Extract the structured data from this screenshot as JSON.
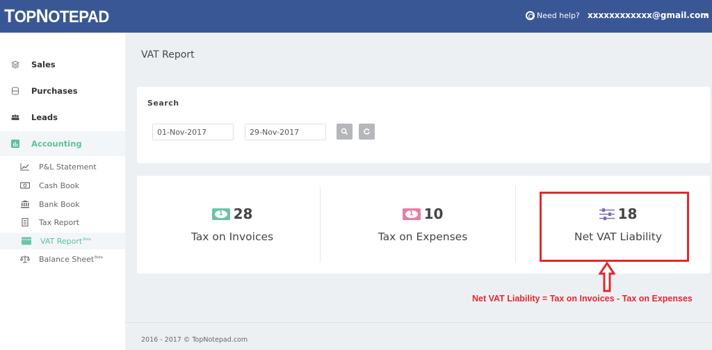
{
  "header": {
    "logo_first": "T",
    "logo_mid": "OP",
    "logo_n": "N",
    "logo_rest": "OTEPAD",
    "help_label": "Need help?",
    "user_email": "xxxxxxxxxxxx@gmail.com",
    "caret": "▾"
  },
  "sidebar": {
    "items": [
      {
        "label": "Sales",
        "icon": "layers-icon"
      },
      {
        "label": "Purchases",
        "icon": "receipt-icon"
      },
      {
        "label": "Leads",
        "icon": "users-icon"
      },
      {
        "label": "Accounting",
        "icon": "bar-chart-icon",
        "active": true
      }
    ],
    "sub_items": [
      {
        "label": "P&L Statement",
        "icon": "line-chart-icon"
      },
      {
        "label": "Cash Book",
        "icon": "money-icon"
      },
      {
        "label": "Bank Book",
        "icon": "bank-icon"
      },
      {
        "label": "Tax Report",
        "icon": "document-icon"
      },
      {
        "label": "VAT Report",
        "badge": "Beta",
        "icon": "table-icon",
        "active": true
      },
      {
        "label": "Balance Sheet",
        "badge": "Beta",
        "icon": "scale-icon"
      }
    ]
  },
  "page": {
    "title": "VAT Report",
    "search": {
      "label": "Search",
      "from_date": "01-Nov-2017",
      "to_date": "29-Nov-2017"
    },
    "stats": [
      {
        "value": "28",
        "label": "Tax on Invoices",
        "icon": "money-icon",
        "color": "#6cc3a6"
      },
      {
        "value": "10",
        "label": "Tax on Expenses",
        "icon": "money-icon",
        "color": "#e57ea5"
      },
      {
        "value": "18",
        "label": "Net VAT Liability",
        "icon": "sliders-icon",
        "color": "#7b6bbf"
      }
    ]
  },
  "annotation": {
    "formula": "Net VAT Liability = Tax on Invoices - Tax on Expenses",
    "color": "#e3272f"
  },
  "footer": {
    "copyright": "2016 - 2017 © TopNotepad.com"
  }
}
